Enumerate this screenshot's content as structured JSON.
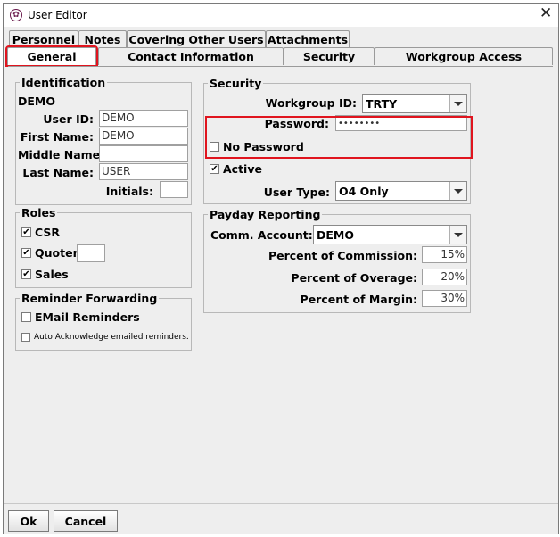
{
  "window": {
    "title": "User Editor"
  },
  "tabs_row1": [
    "Personnel",
    "Notes",
    "Covering Other Users",
    "Attachments"
  ],
  "tabs_row2": [
    "General",
    "Contact Information",
    "Security",
    "Workgroup Access"
  ],
  "identification": {
    "legend": "Identification",
    "header": "DEMO",
    "user_id_label": "User ID:",
    "user_id_value": "DEMO",
    "first_name_label": "First Name:",
    "first_name_value": "DEMO",
    "middle_name_label": "Middle Name:",
    "middle_name_value": "",
    "last_name_label": "Last Name:",
    "last_name_value": "USER",
    "initials_label": "Initials:",
    "initials_value": ""
  },
  "roles": {
    "legend": "Roles",
    "csr_label": "CSR",
    "csr_checked": "✔",
    "quoter_label": "Quoter",
    "quoter_checked": "✔",
    "quoter_value": "",
    "sales_label": "Sales",
    "sales_checked": "✔"
  },
  "reminder": {
    "legend": "Reminder Forwarding",
    "email_label": "EMail Reminders",
    "auto_label": "Auto Acknowledge emailed reminders."
  },
  "security": {
    "legend": "Security",
    "workgroup_label": "Workgroup ID:",
    "workgroup_value": "TRTY",
    "password_label": "Password:",
    "password_value": "••••••••",
    "no_password_label": "No Password",
    "active_label": "Active",
    "active_checked": "✔",
    "user_type_label": "User Type:",
    "user_type_value": "O4 Only"
  },
  "payday": {
    "legend": "Payday Reporting",
    "comm_account_label": "Comm. Account:",
    "comm_account_value": "DEMO",
    "commission_label": "Percent of Commission:",
    "commission_value": "15%",
    "overage_label": "Percent of Overage:",
    "overage_value": "20%",
    "margin_label": "Percent of Margin:",
    "margin_value": "30%"
  },
  "buttons": {
    "ok": "Ok",
    "cancel": "Cancel"
  },
  "colors": {
    "highlight": "#e0141e",
    "panel_bg": "#eeeeee"
  }
}
